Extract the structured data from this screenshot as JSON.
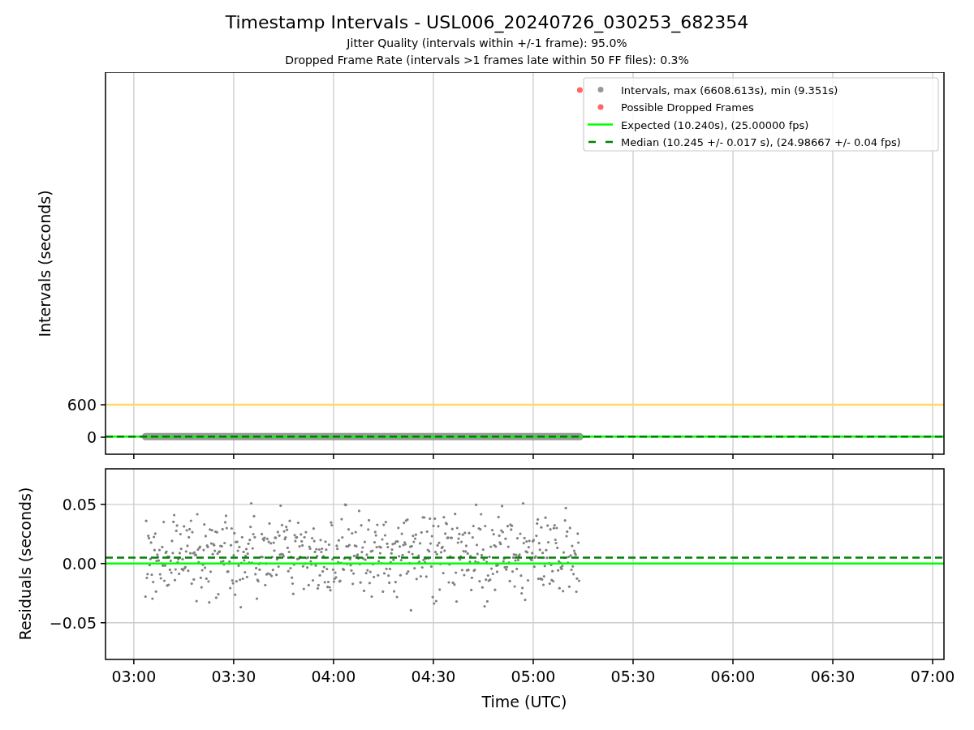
{
  "figure": {
    "title": "Timestamp Intervals - USL006_20240726_030253_682354",
    "subtitles": [
      "Jitter Quality (intervals within +/-1 frame): 95.0%",
      "Dropped Frame Rate (intervals >1 frames late within 50 FF files): 0.3%"
    ]
  },
  "intervals_panel": {
    "chart_data": {
      "type": "line",
      "ylabel": "Intervals (seconds)",
      "legend": true,
      "x": [
        171.5,
        183.5,
        314,
        423.4
      ],
      "xlim": [
        171.5,
        423.4
      ],
      "ylim": [
        -315,
        6750
      ],
      "grid": true,
      "yticks": [
        {
          "value": 0,
          "label": "0"
        },
        {
          "value": 600,
          "label": "600"
        }
      ],
      "series": [
        {
          "color": "#ffd966",
          "line_style": "solid",
          "values": [
            600,
            600,
            600,
            600
          ]
        },
        {
          "name": "Intervals, max (6608.613s), min (9.351s)",
          "color": "#999999",
          "values": [
            null,
            10,
            10,
            null
          ]
        },
        {
          "name": "Possible Dropped Frames",
          "color": "#ff6666",
          "marker": "circle",
          "values": [
            null,
            null,
            6420,
            null
          ]
        },
        {
          "name": "Expected (10.240s), (25.00000 fps)",
          "color": "#00ff00",
          "line_style": "solid",
          "values": [
            10,
            10,
            10,
            10
          ]
        },
        {
          "name": "Median (10.245 +/- 0.017 s), (24.98667 +/- 0.04 fps)",
          "color": "#008000",
          "line_style": "dashed",
          "values": [
            10,
            10,
            10,
            10
          ]
        }
      ]
    }
  },
  "residuals_panel": {
    "chart_data": {
      "type": "line",
      "xlabel": "Time (UTC)",
      "ylabel": "Residuals (seconds)",
      "x": [
        171.5,
        423.4
      ],
      "xlim": [
        171.5,
        423.4
      ],
      "ylim": [
        -0.081,
        0.08
      ],
      "grid": true,
      "xticks": [
        {
          "value": 180,
          "label": "03:00"
        },
        {
          "value": 210,
          "label": "03:30"
        },
        {
          "value": 240,
          "label": "04:00"
        },
        {
          "value": 270,
          "label": "04:30"
        },
        {
          "value": 300,
          "label": "05:00"
        },
        {
          "value": 330,
          "label": "05:30"
        },
        {
          "value": 360,
          "label": "06:00"
        },
        {
          "value": 390,
          "label": "06:30"
        },
        {
          "value": 420,
          "label": "07:00"
        }
      ],
      "yticks": [
        {
          "value": -0.05,
          "label": "−0.05"
        },
        {
          "value": 0,
          "label": "0.00"
        },
        {
          "value": 0.05,
          "label": "0.05"
        }
      ],
      "series": [
        {
          "color": "#00ff00",
          "line_style": "solid",
          "values": [
            0,
            0
          ]
        },
        {
          "color": "#008000",
          "line_style": "dashed",
          "values": [
            0.005,
            0.005
          ]
        }
      ]
    }
  }
}
